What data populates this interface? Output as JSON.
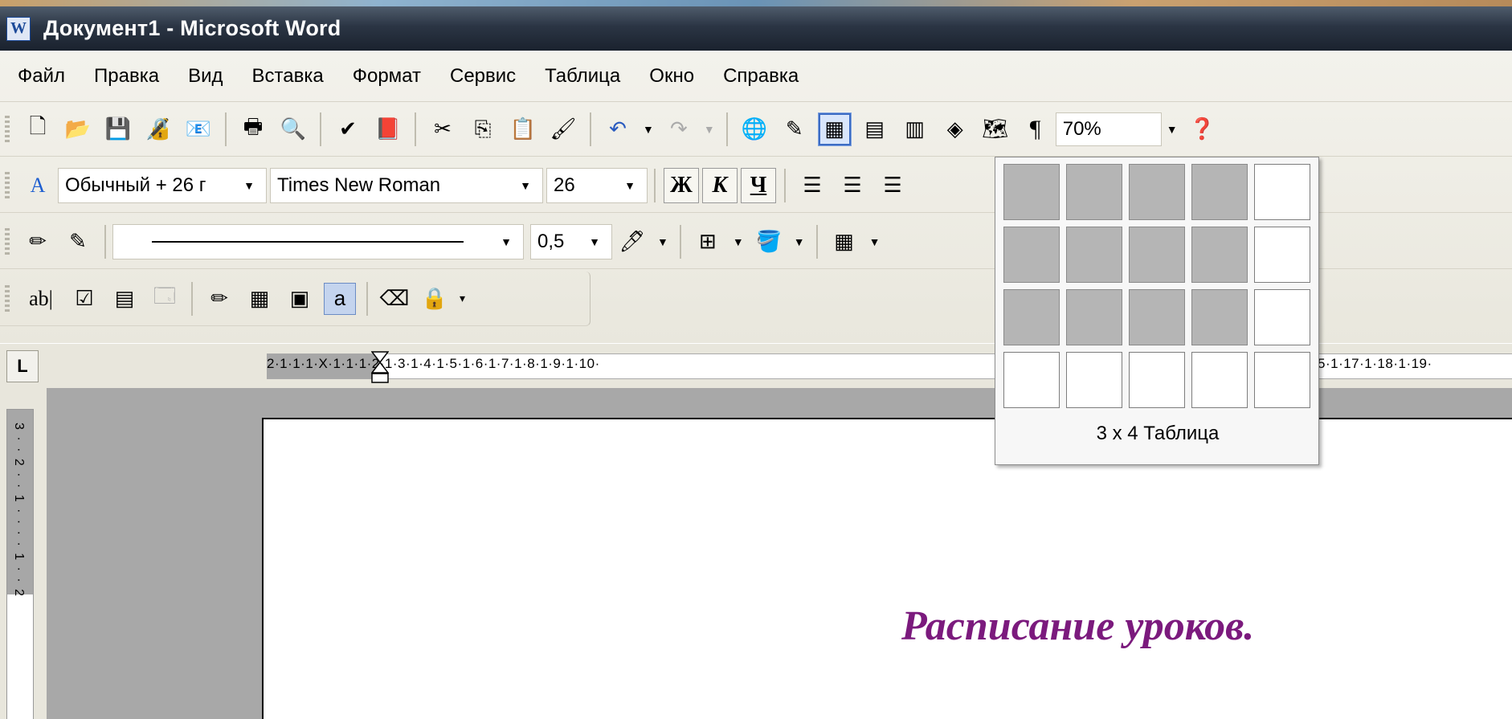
{
  "window": {
    "title": "Документ1 - Microsoft Word",
    "icon": "word-app-icon"
  },
  "menu": {
    "items": [
      {
        "label": "Файл"
      },
      {
        "label": "Правка"
      },
      {
        "label": "Вид"
      },
      {
        "label": "Вставка"
      },
      {
        "label": "Формат"
      },
      {
        "label": "Сервис"
      },
      {
        "label": "Таблица"
      },
      {
        "label": "Окно"
      },
      {
        "label": "Справка"
      }
    ]
  },
  "standard_toolbar": {
    "zoom": "70%",
    "pilcrow": "¶"
  },
  "formatting_toolbar": {
    "style": "Обычный + 26 г",
    "font": "Times New Roman",
    "size": "26",
    "bold": "Ж",
    "italic": "К",
    "underline": "Ч"
  },
  "drawing_toolbar": {
    "line_weight": "0,5"
  },
  "forms_toolbar": {
    "text_field": "ab|"
  },
  "ruler": {
    "tab_selector": "L",
    "h_text": "2·1·1·1·X·1·1·1·2·1·3·1·4·1·5·1·6·1·7·1·8·1·9·1·10·",
    "h_text_right": "5·1·17·1·18·1·19·",
    "v_text": "3 · · 2 · · 1 · · · · 1 · · 2"
  },
  "table_picker": {
    "rows": 4,
    "cols": 5,
    "selected_rows": 3,
    "selected_cols": 4,
    "label": "3 x 4 Таблица"
  },
  "document": {
    "heading": "Расписание уроков."
  },
  "colors": {
    "heading": "#7b1a7d",
    "titlebar": "#2b3544"
  }
}
